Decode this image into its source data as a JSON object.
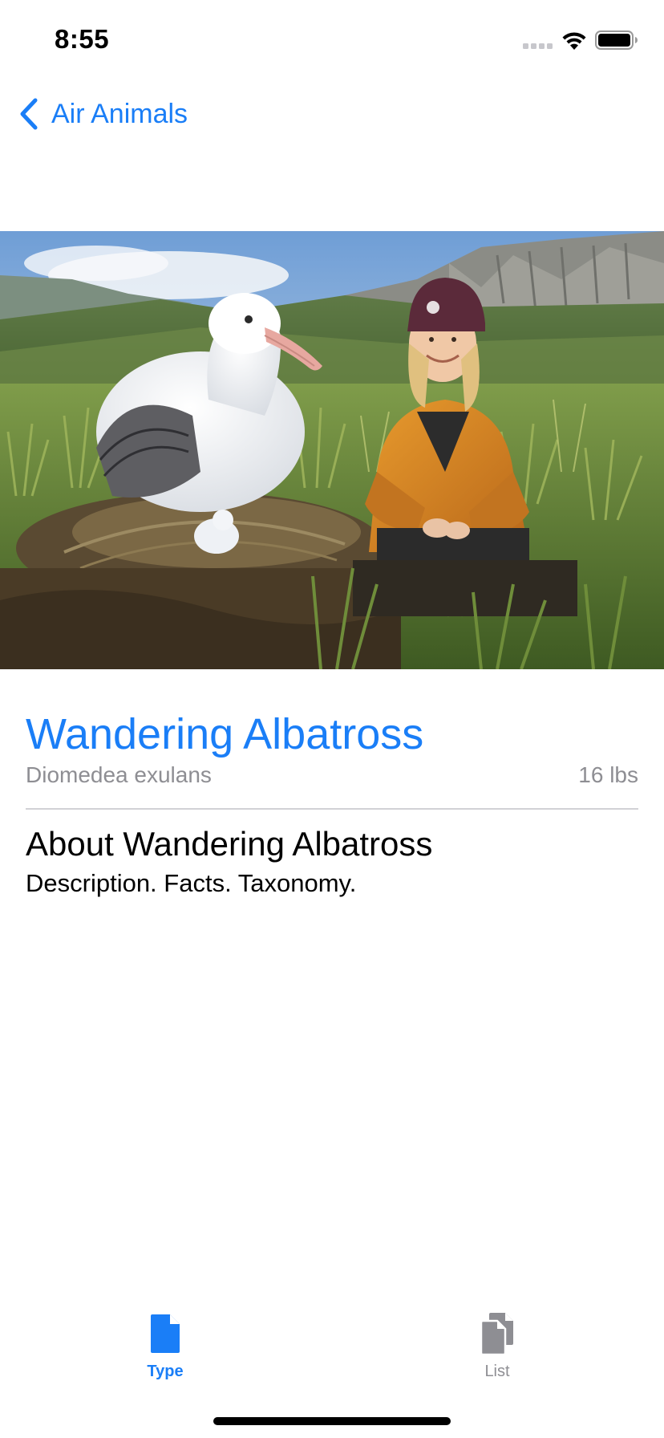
{
  "status_bar": {
    "time": "8:55",
    "signal_icon": "cellular-signal-icon",
    "wifi_icon": "wifi-icon",
    "battery_icon": "battery-icon"
  },
  "nav": {
    "back_label": "Air Animals",
    "back_icon": "chevron-left-icon"
  },
  "hero": {
    "icon": "albatross-photo"
  },
  "animal": {
    "name": "Wandering Albatross",
    "scientific_name": "Diomedea exulans",
    "weight": "16 lbs"
  },
  "about": {
    "title": "About Wandering Albatross",
    "subtitle": "Description. Facts. Taxonomy."
  },
  "tabbar": {
    "tabs": [
      {
        "label": "Type",
        "icon": "doc-fill-icon",
        "selected": true
      },
      {
        "label": "List",
        "icon": "docs-icon",
        "selected": false
      }
    ]
  },
  "colors": {
    "accent": "#1a7ef7",
    "secondary_text": "#8e8e93",
    "divider": "#d1d1d6"
  }
}
